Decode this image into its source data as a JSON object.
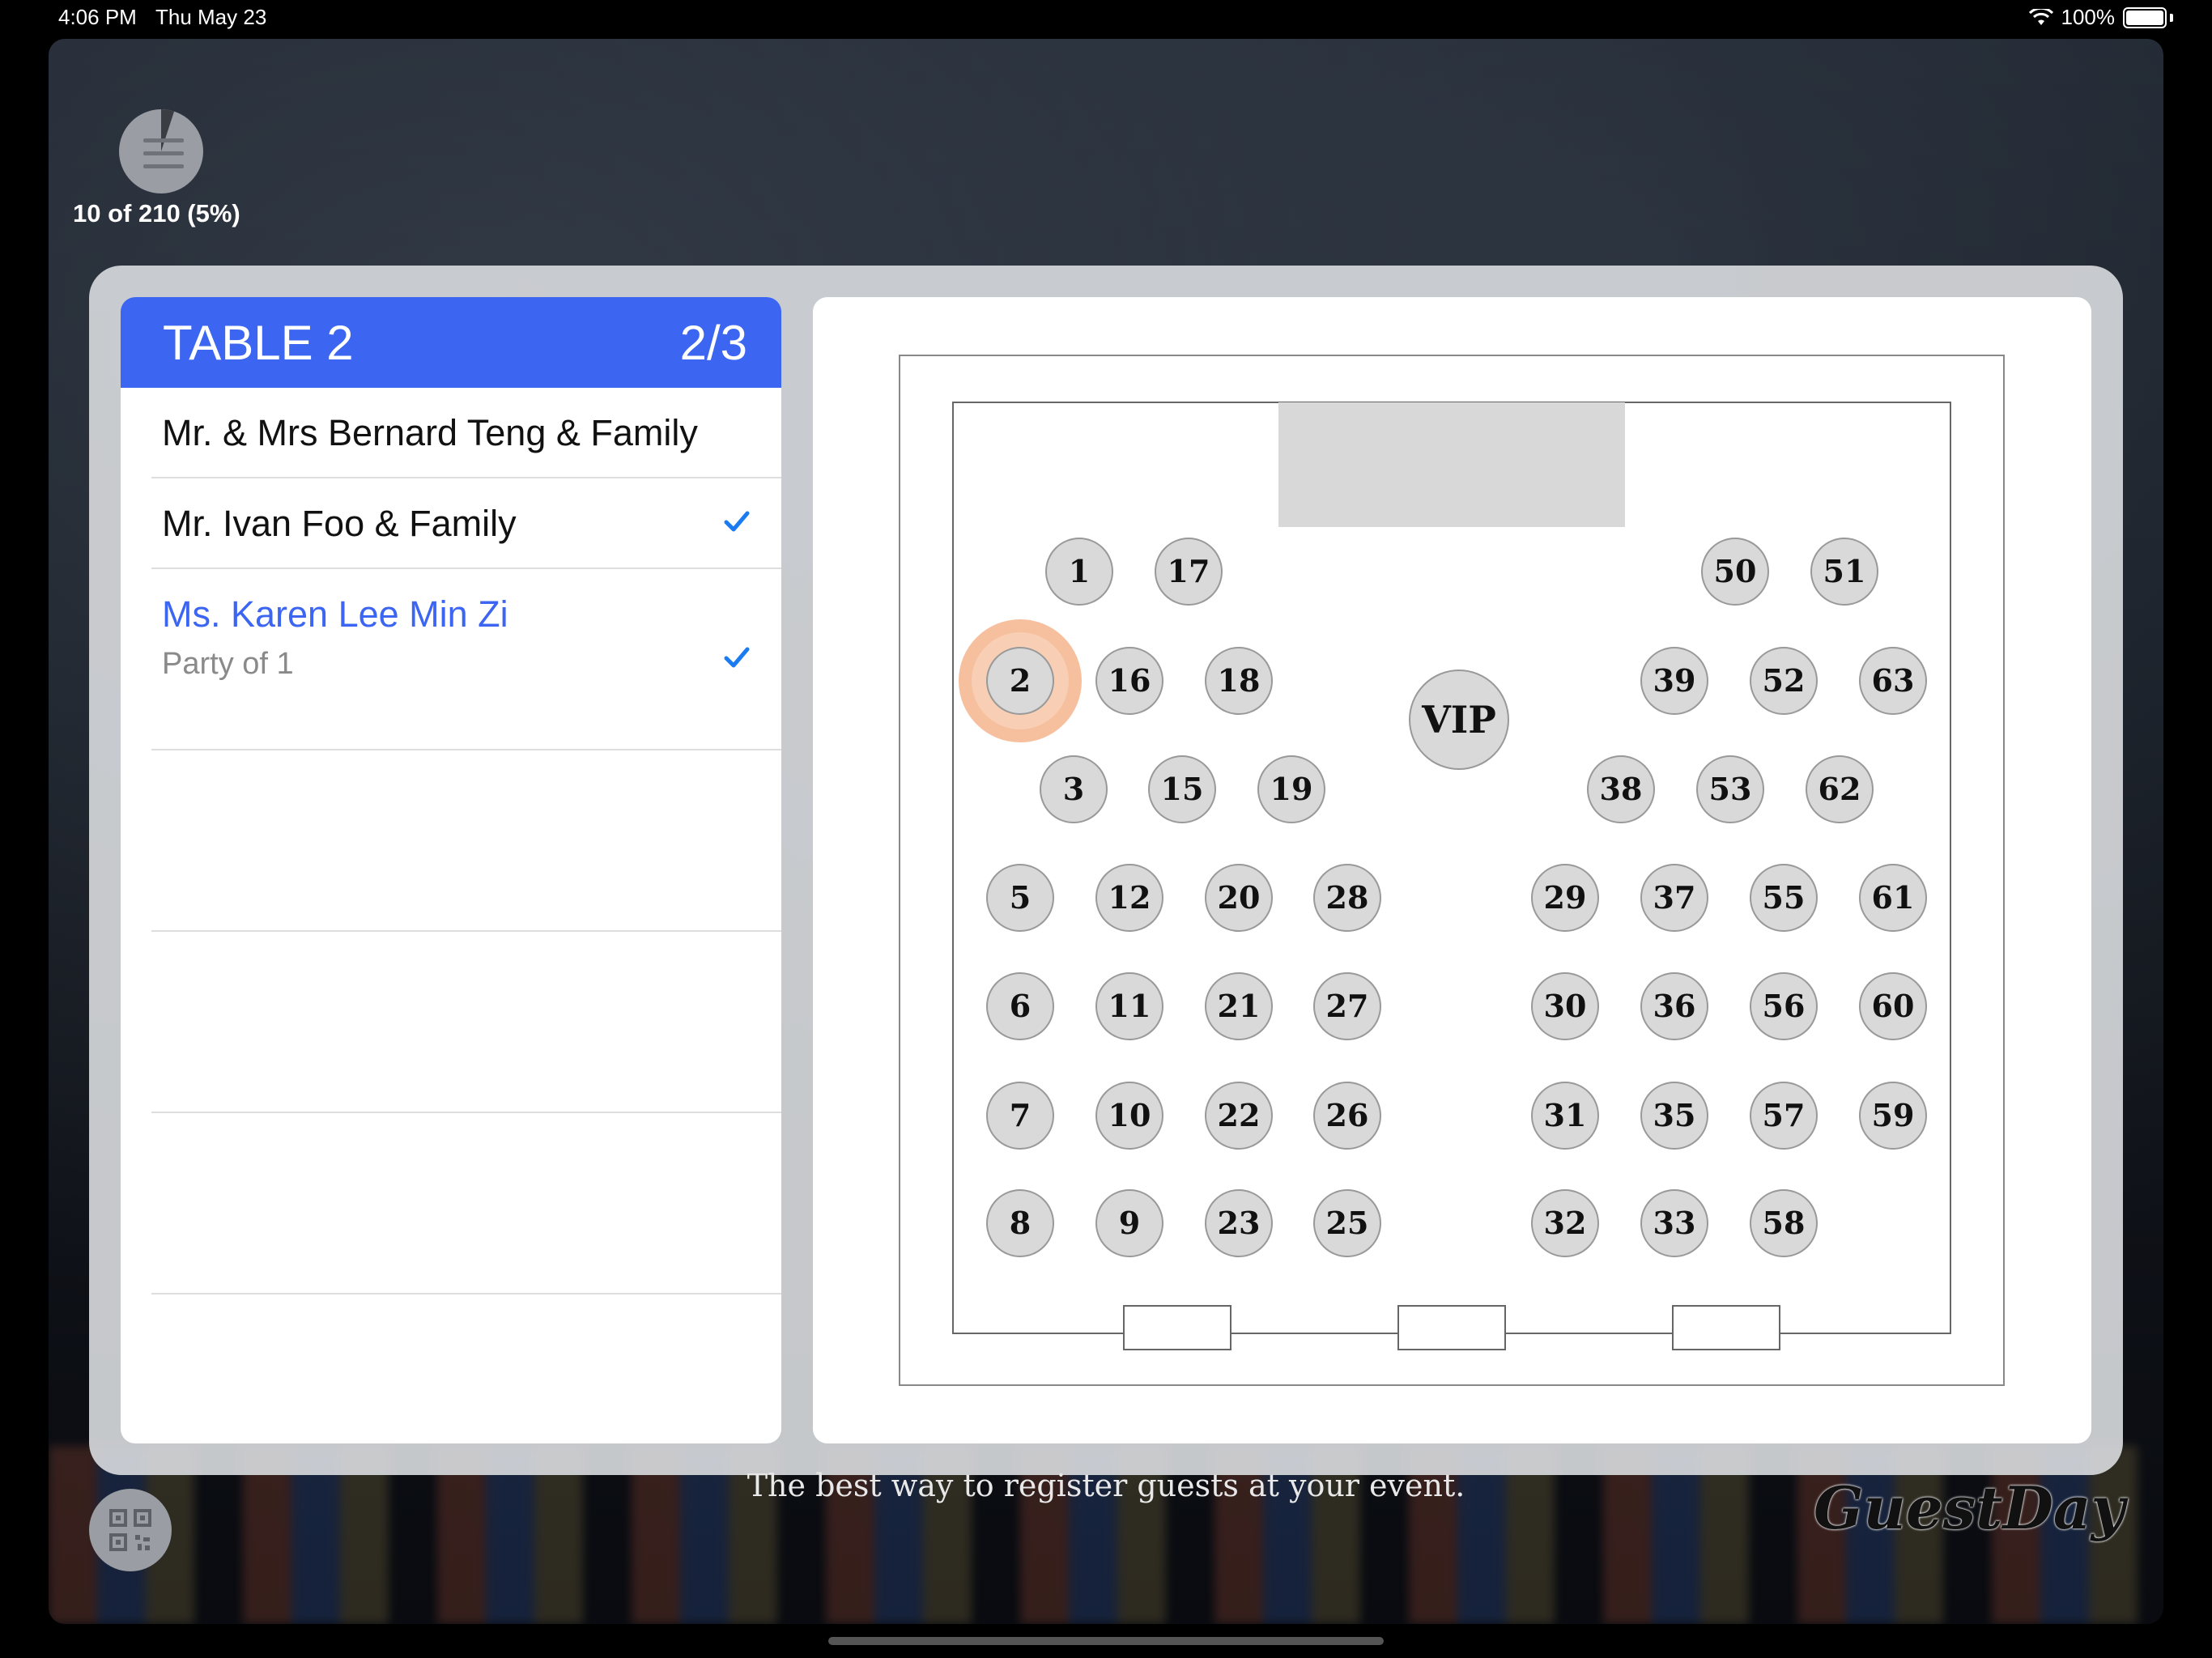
{
  "status_bar": {
    "time": "4:06 PM",
    "date": "Thu May 23",
    "battery": "100%"
  },
  "progress": {
    "text": "10 of 210 (5%)",
    "fraction": 0.05
  },
  "table_card": {
    "title": "TABLE 2",
    "count": "2/3",
    "guests": [
      {
        "name": "Mr. & Mrs Bernard Teng & Family",
        "checked": false
      },
      {
        "name": "Mr. Ivan Foo & Family",
        "checked": true
      },
      {
        "name": "Ms. Karen Lee Min Zi",
        "subtitle": "Party of 1",
        "checked": true,
        "selected": true
      }
    ]
  },
  "floor_plan": {
    "selected_table": "2",
    "vip_label": "VIP",
    "tables": [
      "1",
      "17",
      "50",
      "51",
      "2",
      "16",
      "18",
      "39",
      "52",
      "63",
      "3",
      "15",
      "19",
      "38",
      "53",
      "62",
      "5",
      "12",
      "20",
      "28",
      "29",
      "37",
      "55",
      "61",
      "6",
      "11",
      "21",
      "27",
      "30",
      "36",
      "56",
      "60",
      "7",
      "10",
      "22",
      "26",
      "31",
      "35",
      "57",
      "59",
      "8",
      "9",
      "23",
      "25",
      "32",
      "33",
      "58"
    ]
  },
  "footer": {
    "tagline": "The best way to register guests at your event.",
    "brand": "GuestDay"
  },
  "colors": {
    "accent": "#3c66f2",
    "check": "#1a7cf0",
    "highlight": "#f5a173"
  }
}
